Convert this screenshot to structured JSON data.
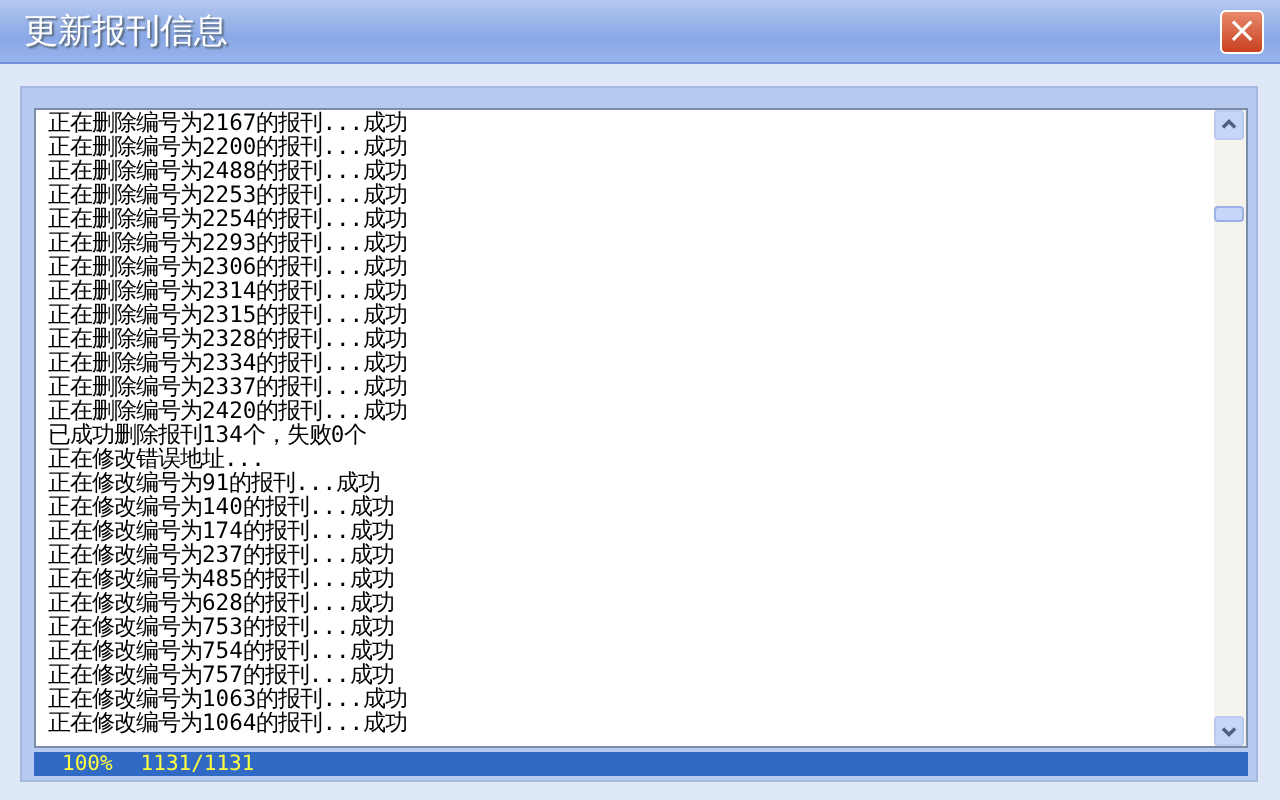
{
  "window": {
    "title": "更新报刊信息",
    "close": "×"
  },
  "log": [
    "正在删除编号为2167的报刊...成功",
    "正在删除编号为2200的报刊...成功",
    "正在删除编号为2488的报刊...成功",
    "正在删除编号为2253的报刊...成功",
    "正在删除编号为2254的报刊...成功",
    "正在删除编号为2293的报刊...成功",
    "正在删除编号为2306的报刊...成功",
    "正在删除编号为2314的报刊...成功",
    "正在删除编号为2315的报刊...成功",
    "正在删除编号为2328的报刊...成功",
    "正在删除编号为2334的报刊...成功",
    "正在删除编号为2337的报刊...成功",
    "正在删除编号为2420的报刊...成功",
    "已成功删除报刊134个，失败0个",
    "正在修改错误地址...",
    "正在修改编号为91的报刊...成功",
    "正在修改编号为140的报刊...成功",
    "正在修改编号为174的报刊...成功",
    "正在修改编号为237的报刊...成功",
    "正在修改编号为485的报刊...成功",
    "正在修改编号为628的报刊...成功",
    "正在修改编号为753的报刊...成功",
    "正在修改编号为754的报刊...成功",
    "正在修改编号为757的报刊...成功",
    "正在修改编号为1063的报刊...成功",
    "正在修改编号为1064的报刊...成功"
  ],
  "progress": {
    "level": 1,
    "percent": "100%",
    "count": "1131/1131"
  }
}
